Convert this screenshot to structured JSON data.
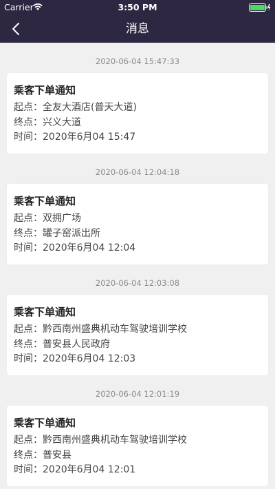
{
  "status_bar": {
    "carrier": "Carrier",
    "time": "3:50 PM"
  },
  "nav": {
    "title": "消息",
    "back_icon": "chevron-left-icon"
  },
  "colors": {
    "header_bg": "#2d2742",
    "page_bg": "#f0f0f0",
    "battery": "#4cd964"
  },
  "messages": [
    {
      "timestamp": "2020-06-04 15:47:33",
      "title": "乘客下单通知",
      "start": "起点：全友大酒店(普天大道)",
      "end": "终点：兴义大道",
      "time": "时间：2020年6月04 15:47"
    },
    {
      "timestamp": "2020-06-04 12:04:18",
      "title": "乘客下单通知",
      "start": "起点：双拥广场",
      "end": "终点：罐子窑派出所",
      "time": "时间：2020年6月04 12:04"
    },
    {
      "timestamp": "2020-06-04 12:03:08",
      "title": "乘客下单通知",
      "start": "起点：黔西南州盛典机动车驾驶培训学校",
      "end": "终点：普安县人民政府",
      "time": "时间：2020年6月04 12:03"
    },
    {
      "timestamp": "2020-06-04 12:01:19",
      "title": "乘客下单通知",
      "start": "起点：黔西南州盛典机动车驾驶培训学校",
      "end": "终点：普安县",
      "time": "时间：2020年6月04 12:01"
    }
  ]
}
